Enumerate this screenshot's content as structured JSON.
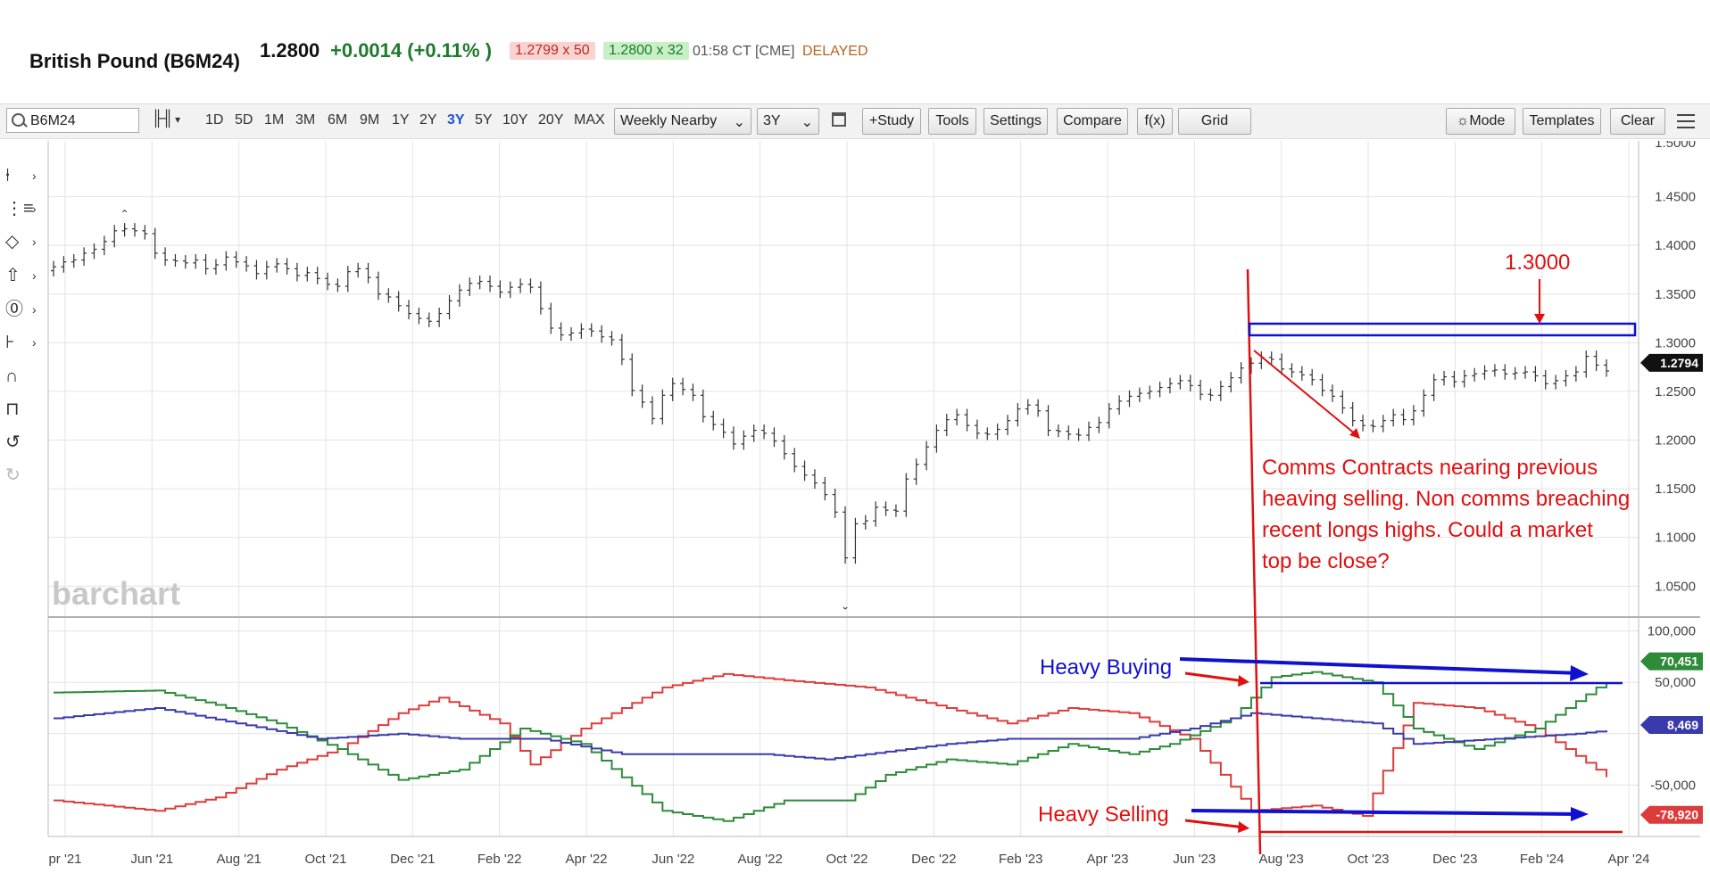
{
  "header": {
    "symbol_name": "British Pound (B6M24)",
    "last_price": "1.2800",
    "change": "+0.0014 (+0.11% )",
    "bid": "1.2799 x 50",
    "ask": "1.2800 x 32",
    "quote_time": "01:58 CT [CME]",
    "delayed_label": "DELAYED"
  },
  "toolbar": {
    "symbol_value": "B6M24",
    "chart_type_icon": "bar-chart-icon",
    "periods": [
      "1D",
      "5D",
      "1M",
      "3M",
      "6M",
      "9M",
      "1Y",
      "2Y",
      "3Y",
      "5Y",
      "10Y",
      "20Y",
      "MAX"
    ],
    "active_period": "3Y",
    "aggregation": "Weekly Nearby",
    "range": "3Y",
    "study_label": "+Study",
    "tools_label": "Tools",
    "settings_label": "Settings",
    "compare_label": "Compare",
    "fx_label": "f(x)",
    "grid_label": "Grid",
    "mode_label": "Mode",
    "templates_label": "Templates",
    "clear_label": "Clear"
  },
  "left_tools": [
    "crosshair-icon",
    "fibonacci-icon",
    "shapes-icon",
    "arrow-up-icon",
    "text-icon",
    "measure-icon",
    "magnet-icon",
    "lock-icon",
    "undo-icon",
    "redo-icon"
  ],
  "watermark": "barchart",
  "chart_data": {
    "type": "bar",
    "price_axis": {
      "ticks": [
        "1.4500",
        "1.4000",
        "1.3500",
        "1.3000",
        "1.2500",
        "1.2000",
        "1.1500",
        "1.1000",
        "1.0500"
      ],
      "top_partial_tick": "1.5000",
      "ylim": [
        1.02,
        1.5
      ],
      "last_value_label": "1.2794"
    },
    "cot_axis": {
      "ticks": [
        "100,000",
        "50,000",
        "-50,000"
      ],
      "ylim": [
        -100000,
        110000
      ],
      "commercials_last": "-78,920",
      "large_specs_last": "70,451",
      "small_specs_last": "8,469",
      "colors": {
        "commercials": "#dd3c3c",
        "large_specs": "#2e8b3a",
        "small_specs": "#3a3aaa"
      }
    },
    "x_tick_labels": [
      "pr '21",
      "Jun '21",
      "Aug '21",
      "Oct '21",
      "Dec '21",
      "Feb '22",
      "Apr '22",
      "Jun '22",
      "Aug '22",
      "Oct '22",
      "Dec '22",
      "Feb '23",
      "Apr '23",
      "Jun '23",
      "Aug '23",
      "Oct '23",
      "Dec '23",
      "Feb '24",
      "Apr '24"
    ],
    "weekly_close": [
      1.378,
      1.383,
      1.385,
      1.392,
      1.396,
      1.404,
      1.415,
      1.417,
      1.415,
      1.412,
      1.392,
      1.385,
      1.384,
      1.382,
      1.385,
      1.376,
      1.38,
      1.388,
      1.383,
      1.379,
      1.371,
      1.378,
      1.381,
      1.376,
      1.369,
      1.372,
      1.366,
      1.36,
      1.358,
      1.373,
      1.376,
      1.367,
      1.35,
      1.347,
      1.338,
      1.33,
      1.325,
      1.322,
      1.33,
      1.343,
      1.354,
      1.361,
      1.363,
      1.358,
      1.352,
      1.357,
      1.36,
      1.357,
      1.335,
      1.315,
      1.308,
      1.31,
      1.314,
      1.312,
      1.306,
      1.303,
      1.283,
      1.251,
      1.239,
      1.222,
      1.246,
      1.258,
      1.252,
      1.246,
      1.224,
      1.216,
      1.208,
      1.196,
      1.204,
      1.21,
      1.207,
      1.199,
      1.186,
      1.173,
      1.164,
      1.156,
      1.144,
      1.126,
      1.079,
      1.114,
      1.117,
      1.131,
      1.128,
      1.127,
      1.16,
      1.175,
      1.193,
      1.21,
      1.221,
      1.226,
      1.215,
      1.207,
      1.206,
      1.211,
      1.22,
      1.232,
      1.236,
      1.23,
      1.21,
      1.209,
      1.206,
      1.205,
      1.213,
      1.218,
      1.232,
      1.24,
      1.245,
      1.248,
      1.25,
      1.254,
      1.258,
      1.261,
      1.256,
      1.247,
      1.246,
      1.255,
      1.264,
      1.274,
      1.279,
      1.285,
      1.283,
      1.273,
      1.27,
      1.267,
      1.262,
      1.251,
      1.245,
      1.233,
      1.22,
      1.215,
      1.214,
      1.22,
      1.226,
      1.221,
      1.23,
      1.246,
      1.262,
      1.265,
      1.26,
      1.266,
      1.268,
      1.271,
      1.272,
      1.268,
      1.269,
      1.27,
      1.266,
      1.258,
      1.261,
      1.266,
      1.27,
      1.286,
      1.277,
      1.271
    ]
  },
  "annotations": {
    "level_label": "1.3000",
    "note_lines": [
      "Comms Contracts nearing previous",
      "heaving selling. Non comms breaching",
      "recent longs highs. Could a market",
      "top be close?"
    ],
    "heavy_buying": "Heavy Buying",
    "heavy_selling": "Heavy Selling"
  }
}
